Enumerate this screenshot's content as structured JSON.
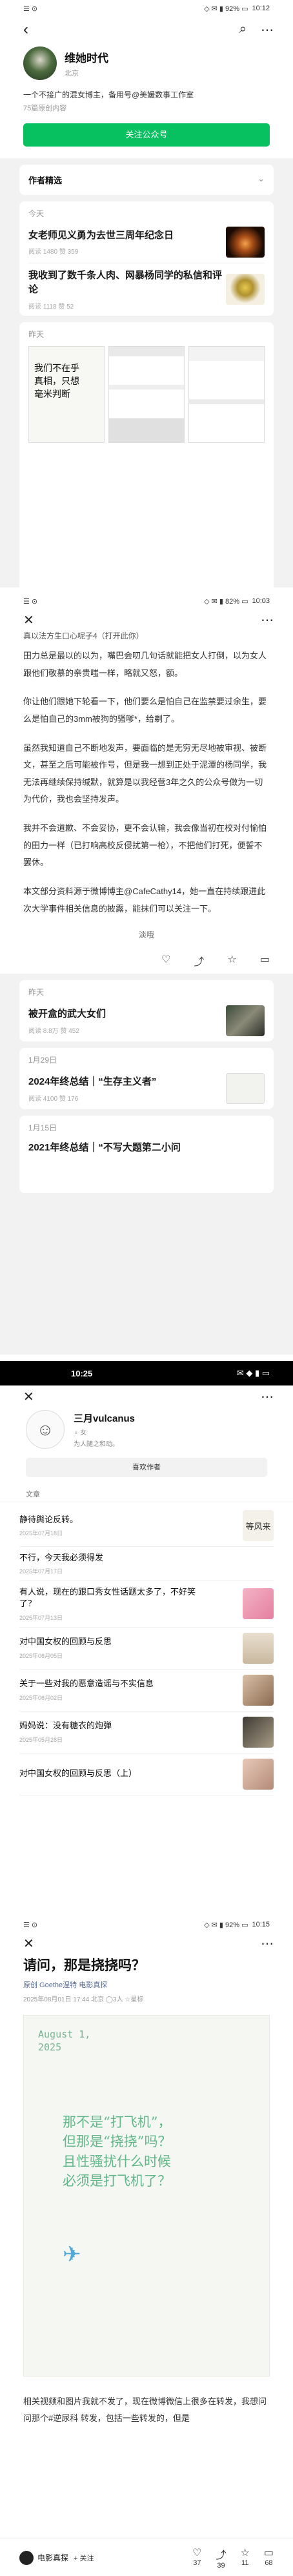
{
  "s1": {
    "status": {
      "time": "10:12",
      "info": "◇ ✉ ▮ 92% ▭"
    },
    "name": "维她时代",
    "location": "北京",
    "bio": "一个不接广的混女博主，备用号@美媛数事工作室",
    "followers": "75篇原创内容",
    "follow_btn": "关注公众号",
    "tabs_label": "作者精选",
    "today": "今天",
    "a1": {
      "title": "女老师见义勇为去世三周年纪念日",
      "meta": "阅读 1480  赞 359"
    },
    "a2": {
      "title": "我收到了数千条人肉、网暴杨同学的私信和评论",
      "meta": "阅读 1118  赞 52"
    },
    "yesterday": "昨天",
    "note_img_text": "我们不在乎\n真相，只想\n毫米判断"
  },
  "s2": {
    "status": {
      "time": "10:03",
      "info": "◇ ✉ ▮ 82% ▭"
    },
    "top_line": "真以法方生口心呢子4（打开此你）",
    "paras": [
      "田力总是最以的以为，嘴巴会叨几句话就能把女人打倒，以为女人跟他们敬慕的亲贵嗤一样，略就又怒，额。",
      "你让他们跟她下轮看一下，他们要么是怕自己在监禁要过余生，要么是怕自己的3mm被狗的骚嗲*，给剃了。",
      "虽然我知道自己不断地发声，要面临的是无穷无尽地被审视、被断文，甚至之后可能被作号，但是我一想到正处于泥潭的杨同学，我无法再继续保持缄默，就算是以我经营3年之久的公众号做为一切为代价，我也会坚持发声。",
      "我并不会道歉、不会妥协，更不会认输，我会像当初在校对付愉怕的田力一样（已打响高校反侵扰第一枪），不把他们打死，便誓不罢休。",
      "本文部分资料源于微博博主@CafeCathy14，她一直在持续跟进此次大学事件相关信息的披露，能抹们可以关注一下。"
    ],
    "sign": "淡哦",
    "yesterday": "昨天",
    "a1": {
      "title": "被开盒的武大女们",
      "meta": "阅读 8.8万  赞 452"
    },
    "d1": "1月29日",
    "a2": {
      "title": "2024年终总结｜“生存主义者”",
      "meta": "阅读 4100  赞 176"
    },
    "d2": "1月15日",
    "a3": {
      "title": "2021年终总结｜“不写大题第二小问"
    }
  },
  "s3": {
    "status": {
      "time": "10:25",
      "info": "✉ ◆ ▮ ▭"
    },
    "name": "三月vulcanus",
    "gender": "♀ 女",
    "bio": "为人随之和动。",
    "btn": "喜欢作者",
    "section": "文章",
    "items": [
      {
        "t": "静待舆论反转。",
        "d": "2025年07月18日"
      },
      {
        "t": "不行，今天我必须得发",
        "d": "2025年07月17日"
      },
      {
        "t": "有人说，现在的跟口秀女性话题太多了，不好笑了？",
        "d": "2025年07月13日"
      },
      {
        "t": "对中国女权的回顾与反思",
        "d": "2025年06月05日"
      },
      {
        "t": "关于一些对我的恶意造谣与不实信息",
        "d": "2025年06月02日"
      },
      {
        "t": "妈妈说：没有糖衣的炮弹",
        "d": "2025年05月28日"
      },
      {
        "t": "对中国女权的回顾与反思（上）",
        "d": ""
      }
    ],
    "side_img_text": "等风来"
  },
  "s4": {
    "status": {
      "time": "10:15",
      "info": "◇ ✉ ▮ 92% ▭"
    },
    "title": "请问，那是挠挠吗？",
    "meta1": "原创  Goethe涅特  电影真探",
    "meta2": "2025年08月01日 17:44  北京  ◯3人  ☆星标",
    "date": "August 1,\n2025",
    "card_lines": [
      "那不是“打飞机”，",
      "但那是“挠挠”吗？",
      "且性骚扰什么时候",
      "必须是打飞机了？"
    ],
    "plane": "✈",
    "body": "相关视频和图片我就不发了，现在微博微信上很多在转发，我想问问那个#逆尿科 转发，包括一些转发的，但是",
    "bottom": {
      "name": "电影真探",
      "follow": "+ 关注",
      "c1": "37",
      "c2": "39",
      "c3": "11",
      "c4": "68"
    }
  }
}
